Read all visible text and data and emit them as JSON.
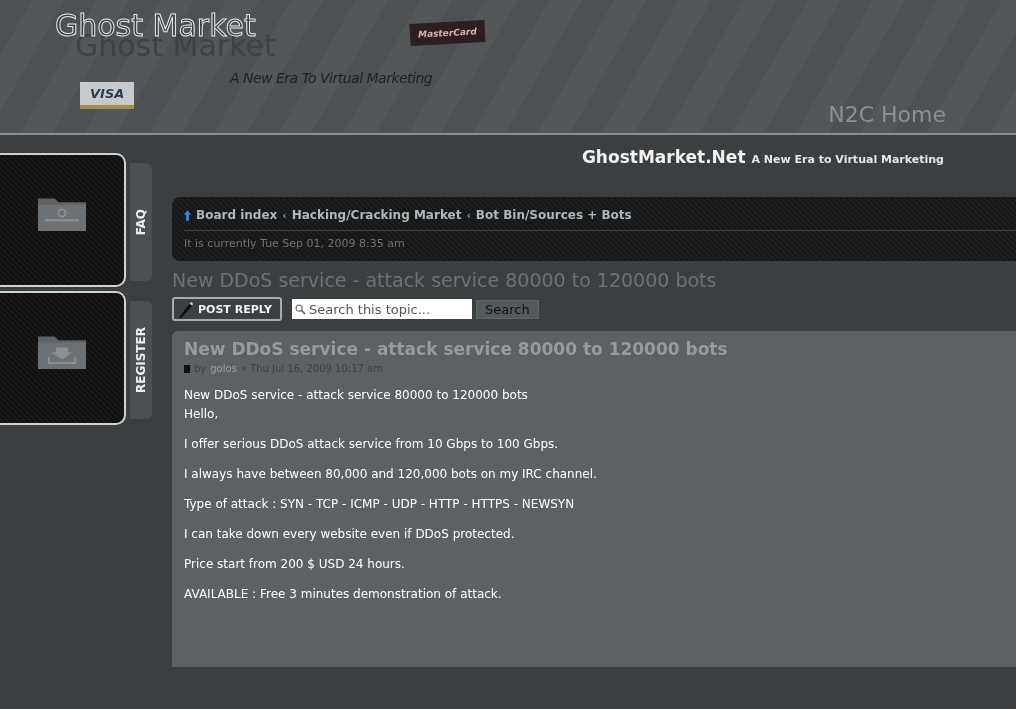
{
  "header": {
    "logo": "Ghost Market",
    "logo_shadow": "Ghost Market",
    "tagline": "A New Era To Virtual Marketing",
    "card_marks": [
      "MasterCard",
      "VISA"
    ],
    "home_link": "N2C Home"
  },
  "side_tabs": [
    {
      "label": "FAQ"
    },
    {
      "label": "REGISTER"
    }
  ],
  "site_title": {
    "name": "GhostMarket.Net",
    "slogan": "A New Era to Virtual Marketing"
  },
  "breadcrumbs": [
    "Board index",
    "Hacking/Cracking Market",
    "Bot Bin/Sources + Bots"
  ],
  "breadcrumb_separator": "‹",
  "current_time": "It is currently Tue Sep 01, 2009 8:35 am",
  "topic_title": "New DDoS service - attack service 80000 to 120000 bots",
  "post_reply": "POST REPLY",
  "search": {
    "placeholder": "Search this topic...",
    "button": "Search"
  },
  "post": {
    "title": "New DDoS service - attack service 80000 to 120000 bots",
    "by": "by",
    "author": "golos",
    "date": "» Thu Jul 16, 2009 10:17 am",
    "paragraphs": [
      {
        "lines": [
          "New DDoS service - attack service 80000 to 120000 bots",
          "Hello,"
        ]
      },
      {
        "lines": [
          "I offer serious DDoS attack service from 10 Gbps to 100 Gbps."
        ]
      },
      {
        "lines": [
          "I always have between 80,000 and 120,000 bots on my IRC channel."
        ]
      },
      {
        "lines": [
          "Type of attack : SYN - TCP - ICMP - UDP - HTTP - HTTPS - NEWSYN"
        ]
      },
      {
        "lines": [
          "I can take down every website even if DDoS protected."
        ]
      },
      {
        "lines": [
          "Price start from 200 $ USD 24 hours."
        ]
      },
      {
        "lines": [
          "AVAILABLE : Free 3 minutes demonstration of attack."
        ]
      }
    ]
  }
}
